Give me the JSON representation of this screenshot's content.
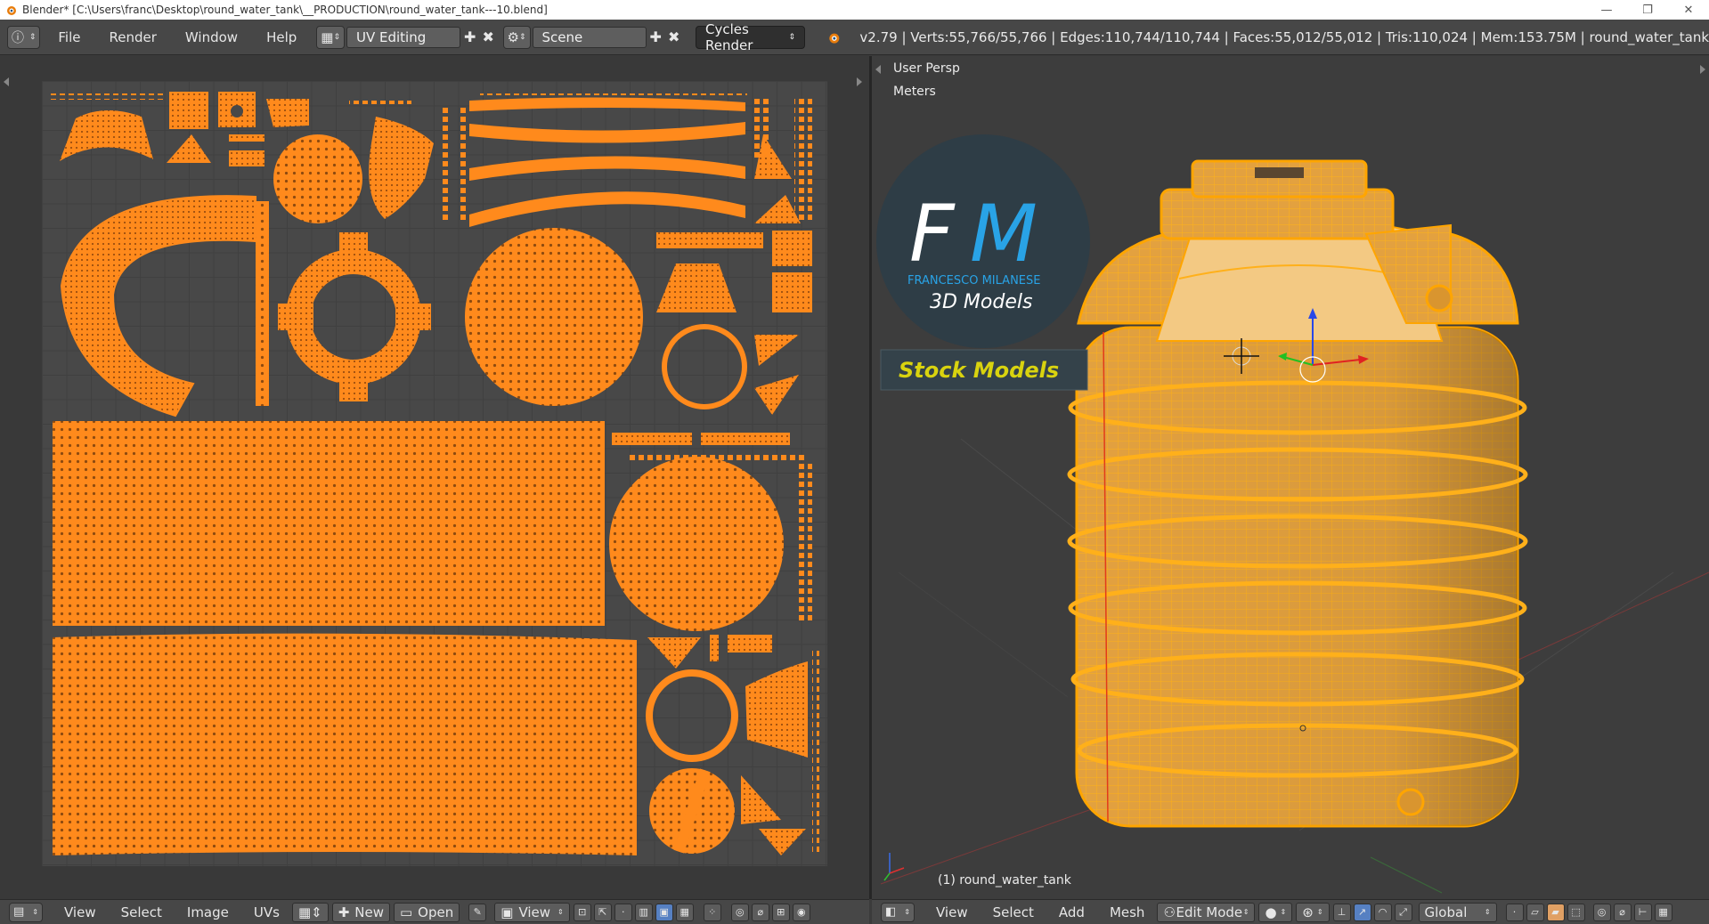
{
  "window": {
    "title": "Blender* [C:\\Users\\franc\\Desktop\\round_water_tank\\__PRODUCTION\\round_water_tank---10.blend]",
    "minimize": "—",
    "maximize": "❐",
    "close": "✕"
  },
  "info_header": {
    "menus": [
      "File",
      "Render",
      "Window",
      "Help"
    ],
    "screen_layout": "UV Editing",
    "scene": "Scene",
    "render_engine": "Cycles Render",
    "stats": "v2.79 | Verts:55,766/55,766 | Edges:110,744/110,744 | Faces:55,012/55,012 | Tris:110,024 | Mem:153.75M | round_water_tank"
  },
  "uv_editor": {
    "menus": [
      "View",
      "Select",
      "Image",
      "UVs"
    ],
    "new_label": "New",
    "open_label": "Open",
    "view_label": "View"
  },
  "viewport": {
    "view_name": "User Persp",
    "units": "Meters",
    "object_label": "(1) round_water_tank",
    "menus": [
      "View",
      "Select",
      "Add",
      "Mesh"
    ],
    "mode": "Edit Mode",
    "orientation": "Global",
    "watermark": {
      "brand_letters_1": "F",
      "brand_letters_2": "M",
      "author": "FRANCESCO MILANESE",
      "tagline": "3D Models",
      "banner": "Stock Models"
    }
  },
  "colors": {
    "uv_island": "#ff8a1c",
    "mesh_orange": "#ffa500",
    "selected_edge": "#ff9a00",
    "accent_blue": "#29a3e6",
    "banner_text": "#d9d30f"
  }
}
